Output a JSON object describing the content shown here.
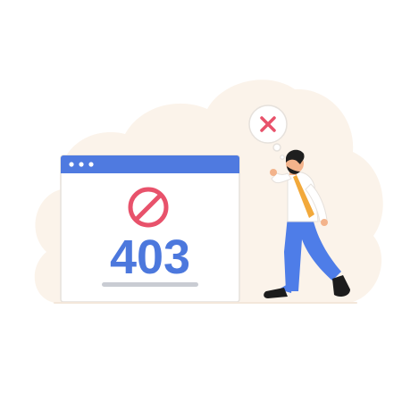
{
  "error": {
    "code": "403"
  },
  "icons": {
    "forbidden": "no-entry-icon",
    "deny": "x-mark-icon"
  },
  "colors": {
    "background_blob": "#FBF3EA",
    "browser_bar": "#4F7AE0",
    "browser_window": "#FFFFFF",
    "outline": "#E6E1DC",
    "forbidden_red": "#E8526B",
    "code_blue": "#4C78DD",
    "placeholder_line": "#C9CCD3",
    "trousers": "#4E7DE8",
    "shirt": "#FFFFFF",
    "tie": "#F2A93B",
    "skin": "#F3B38B",
    "hair": "#1F1F1F",
    "shoes": "#1C1C1C"
  }
}
